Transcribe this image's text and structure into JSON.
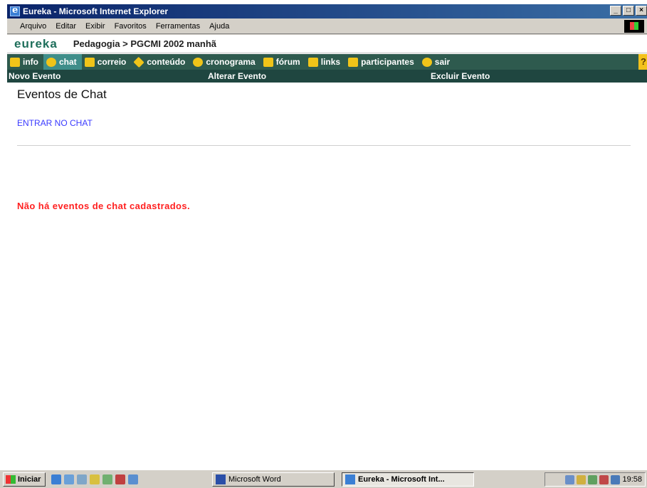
{
  "window": {
    "title": "Eureka - Microsoft Internet Explorer"
  },
  "menubar": {
    "items": [
      "Arquivo",
      "Editar",
      "Exibir",
      "Favoritos",
      "Ferramentas",
      "Ajuda"
    ]
  },
  "brand": {
    "logo": "eureka",
    "breadcrumb": "Pedagogia > PGCMI 2002 manhã"
  },
  "nav": {
    "items": [
      {
        "label": "info",
        "icon": "info-icon"
      },
      {
        "label": "chat",
        "icon": "chat-icon",
        "active": true
      },
      {
        "label": "correio",
        "icon": "mail-icon"
      },
      {
        "label": "conteúdo",
        "icon": "content-icon"
      },
      {
        "label": "cronograma",
        "icon": "clock-icon"
      },
      {
        "label": "fórum",
        "icon": "forum-icon"
      },
      {
        "label": "links",
        "icon": "links-icon"
      },
      {
        "label": "participantes",
        "icon": "participants-icon"
      },
      {
        "label": "sair",
        "icon": "exit-icon"
      }
    ],
    "help": "?"
  },
  "subnav": {
    "new_event": "Novo Evento",
    "edit_event": "Alterar Evento",
    "delete_event": "Excluir Evento"
  },
  "main": {
    "title": "Eventos de Chat",
    "enter_chat": "ENTRAR NO CHAT",
    "empty_message": "Não há eventos de chat cadastrados."
  },
  "taskbar": {
    "start": "Iniciar",
    "tasks": [
      "Microsoft Word",
      "Eureka - Microsoft Int..."
    ],
    "clock": "19:58"
  },
  "colors": {
    "nav_bg": "#2e5a4e",
    "nav_active": "#3f8e8a",
    "subnav_bg": "#1f4640",
    "logo": "#1e6e5a",
    "link": "#3a3aff",
    "alert": "#ff2020"
  }
}
